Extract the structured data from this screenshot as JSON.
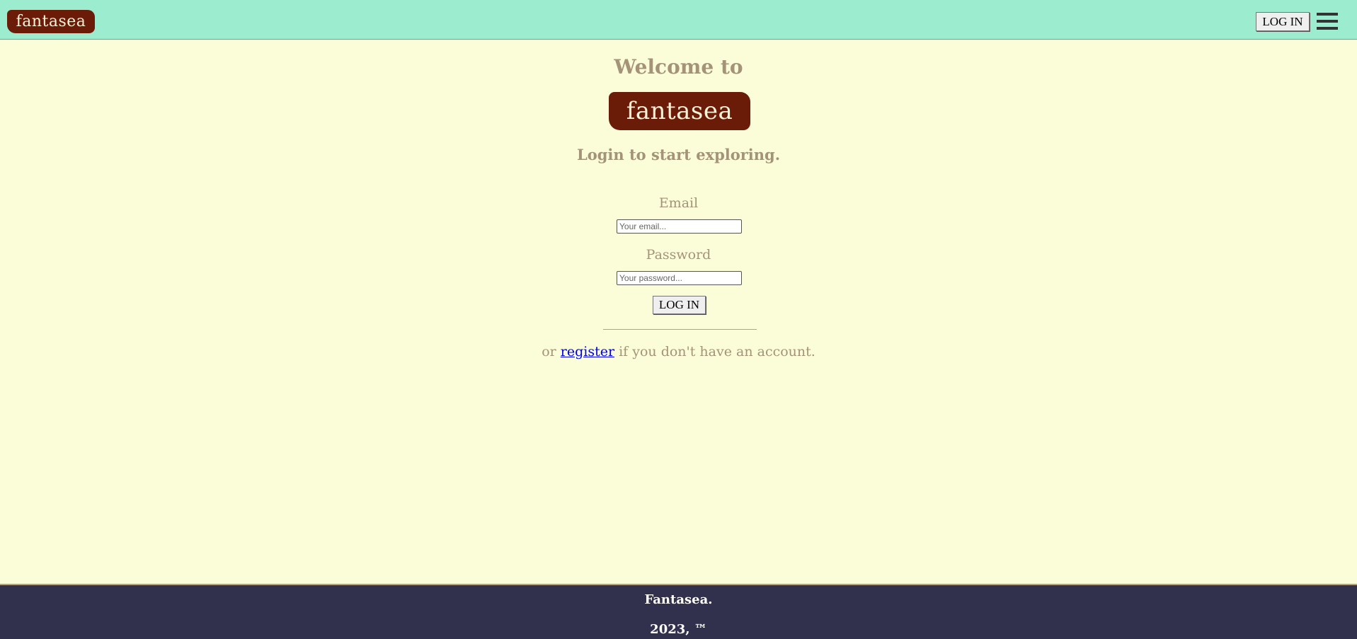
{
  "header": {
    "logo_text": "fantasea",
    "login_label": "LOG IN"
  },
  "main": {
    "welcome": "Welcome to",
    "logo_text": "fantasea",
    "subtitle": "Login to start exploring.",
    "email_label": "Email",
    "email_placeholder": "Your email...",
    "password_label": "Password",
    "password_placeholder": "Your password...",
    "submit_label": "LOG IN",
    "register_prefix": "or",
    "register_link": "register",
    "register_suffix": "if you don't have an account."
  },
  "footer": {
    "line1": "Fantasea.",
    "line2": "2023, ™"
  },
  "colors": {
    "header_bg": "#9cedcf",
    "page_bg": "#fbfdd9",
    "logo_bg": "#6a1c09",
    "text_muted": "#a49378",
    "footer_bg": "#32314d"
  }
}
